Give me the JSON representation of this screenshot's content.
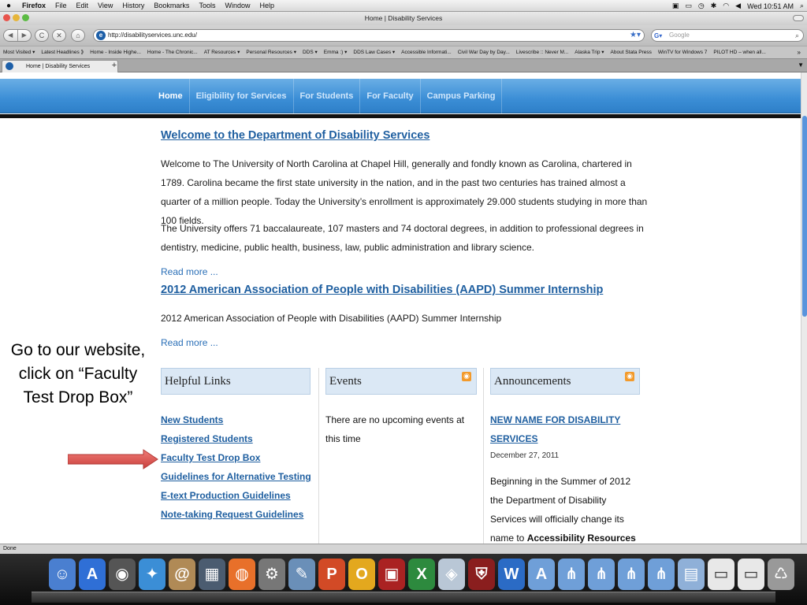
{
  "menubar": {
    "apple": "",
    "app": "Firefox",
    "items": [
      "File",
      "Edit",
      "View",
      "History",
      "Bookmarks",
      "Tools",
      "Window",
      "Help"
    ],
    "clock": "Wed 10:51 AM"
  },
  "window": {
    "title": "Home | Disability Services"
  },
  "toolbar": {
    "url": "http://disabilityservices.unc.edu/",
    "search_placeholder": "Google",
    "back": "◀",
    "forward": "▶",
    "reload": "C",
    "stop": "✕",
    "home": "⌂"
  },
  "bookmarks": [
    "Most Visited ▾",
    "Latest Headlines ⟫",
    "Home - Inside Highe...",
    "Home - The Chronic...",
    "AT Resources ▾",
    "Personal Resources ▾",
    "DDS ▾",
    "Emma :) ▾",
    "DDS Law Cases ▾",
    "Accessible Informati...",
    "Civil War Day by Day...",
    "Livescribe :: Never M...",
    "Alaska Trip ▾",
    "About Stata Press",
    "WinTV for Windows 7",
    "PILOT HD – when all..."
  ],
  "bookmarks_more": "»",
  "tab": {
    "label": "Home | Disability Services",
    "new_tab": "+"
  },
  "site": {
    "nav": [
      "Home",
      "Eligibility for Services",
      "For Students",
      "For Faculty",
      "Campus Parking"
    ],
    "welcome_heading": "Welcome to the Department of Disability Services",
    "welcome_p1": "Welcome to The University of North Carolina at Chapel Hill, generally and fondly known as Carolina, chartered in 1789. Carolina became the first state university in the nation, and in the past two centuries has trained almost a quarter of a million people. Today the University’s enrollment is approximately 29.000 students studying in more than 100 fields.",
    "welcome_p2": "The University offers 71 baccalaureate, 107 masters and 74 doctoral degrees, in addition to professional degrees in dentistry, medicine, public health, business, law, public administration and library science.",
    "read_more": "Read more ...",
    "aapd_heading": "2012 American Association of People with Disabilities (AAPD) Summer Internship",
    "aapd_text": "2012 American Association of People with Disabilities (AAPD) Summer Internship",
    "helpful_links": {
      "title": "Helpful Links",
      "links": [
        "New Students",
        "Registered Students",
        "Faculty Test Drop Box",
        "Guidelines for Alternative Testing",
        "E-text Production Guidelines",
        "Note-taking Request Guidelines"
      ]
    },
    "events": {
      "title": "Events",
      "text": "There are no upcoming events at this time"
    },
    "announcements": {
      "title": "Announcements",
      "item_title": "NEW NAME FOR DISABILITY SERVICES",
      "item_date": "December 27, 2011",
      "item_body": "Beginning in the Summer of 2012 the Department of Disability Services will officially change its name to",
      "item_body_bold": "Accessibility Resources"
    }
  },
  "callout": "Go to our website, click on “Faculty Test Drop Box”",
  "status": "Done",
  "colors": {
    "nav_blue": "#3b8ed6",
    "link_blue": "#1f5fa0",
    "arrow_red": "#e0534f"
  }
}
